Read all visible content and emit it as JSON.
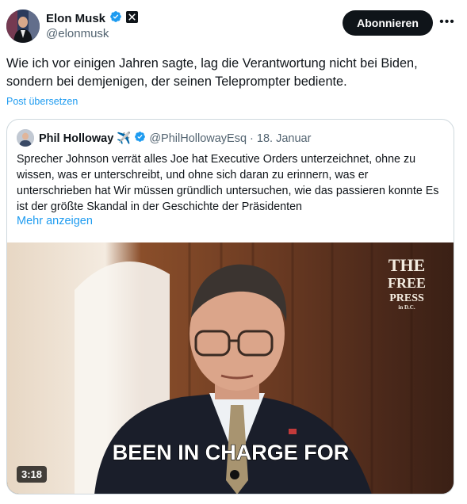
{
  "author": {
    "name": "Elon Musk",
    "handle": "@elonmusk",
    "verified": true,
    "affiliation_icon": "x-logo-icon"
  },
  "actions": {
    "follow_label": "Abonnieren",
    "more_icon": "more-horizontal-icon"
  },
  "post": {
    "text": "Wie ich vor einigen Jahren sagte, lag die Verantwortung nicht bei Biden, sondern bei demjenigen, der seinen Teleprompter bediente.",
    "translate_label": "Post übersetzen"
  },
  "quoted": {
    "name": "Phil Holloway",
    "emoji": "✈️",
    "handle": "@PhilHollowayEsq",
    "separator": "·",
    "date": "18. Januar",
    "text": "Sprecher Johnson verrät alles Joe hat Executive Orders unterzeichnet, ohne zu wissen, was er unterschreibt, und ohne sich daran zu erinnern, was er unterschrieben hat Wir müssen gründlich untersuchen, wie das passieren konnte Es ist der größte Skandal in der Geschichte der Präsidenten",
    "show_more_label": "Mehr anzeigen",
    "video": {
      "caption": "BEEN IN CHARGE FOR",
      "duration": "3:18",
      "watermark_line1": "THE",
      "watermark_line2": "FREE",
      "watermark_line3": "PRESS",
      "watermark_line4": "in D.C."
    }
  },
  "colors": {
    "link": "#1d9bf0",
    "verified": "#1d9bf0",
    "secondary_text": "#536471",
    "primary_text": "#0f1419",
    "border": "#cfd9de"
  }
}
